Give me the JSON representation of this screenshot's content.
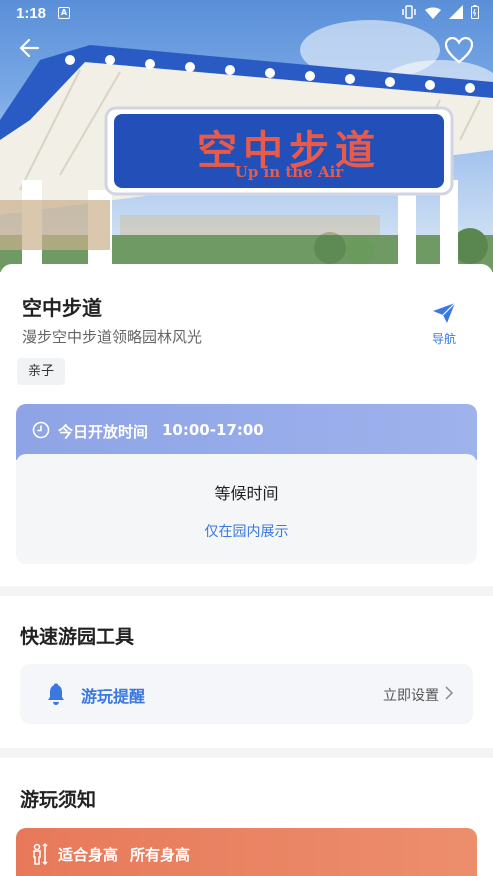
{
  "status_bar": {
    "time": "1:18",
    "notification_letter": "A"
  },
  "hero": {
    "sign_text_cn": "空中步道",
    "sign_text_en": "Up in the Air"
  },
  "attraction": {
    "title": "空中步道",
    "subtitle": "漫步空中步道领略园林风光",
    "nav_label": "导航",
    "tag": "亲子"
  },
  "hours": {
    "label": "今日开放时间",
    "value": "10:00-17:00",
    "wait_label": "等候时间",
    "wait_note": "仅在园内展示"
  },
  "tools": {
    "section_title": "快速游园工具",
    "reminder_label": "游玩提醒",
    "reminder_action": "立即设置"
  },
  "notice": {
    "section_title": "游玩须知",
    "height_label": "适合身高",
    "height_value": "所有身高"
  },
  "colors": {
    "accent_blue": "#3a78e0",
    "hours_header": "#8ea4e6",
    "height_card": "#e7795a"
  }
}
